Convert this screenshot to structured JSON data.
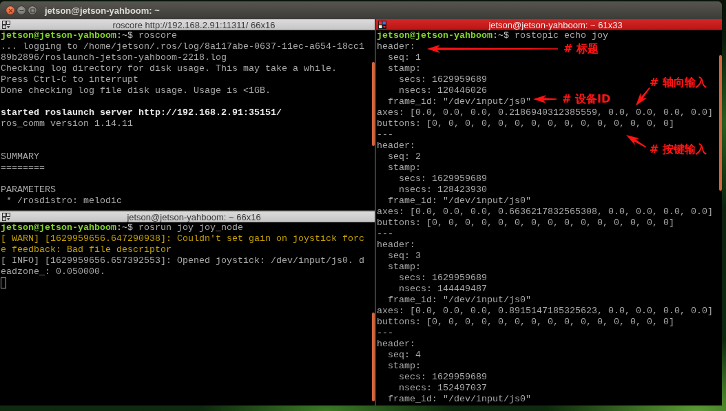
{
  "window": {
    "title": "jetson@jetson-yahboom: ~"
  },
  "columns": [
    {
      "panes": [
        {
          "title": "roscore http://192.168.2.91:11311/ 66x16",
          "focused": false,
          "cursor": false,
          "lines": [
            {
              "kind": "prompt",
              "user_host": "jetson@jetson-yahboom",
              "prompt_end": ":~$",
              "command": "roscore"
            },
            {
              "kind": "text",
              "text": "... logging to /home/jetson/.ros/log/8a117abe-0637-11ec-a654-18cc1"
            },
            {
              "kind": "text",
              "text": "89b2896/roslaunch-jetson-yahboom-2218.log"
            },
            {
              "kind": "text",
              "text": "Checking log directory for disk usage. This may take a while."
            },
            {
              "kind": "text",
              "text": "Press Ctrl-C to interrupt"
            },
            {
              "kind": "text",
              "text": "Done checking log file disk usage. Usage is <1GB."
            },
            {
              "kind": "blank"
            },
            {
              "kind": "bold",
              "text": "started roslaunch server http://192.168.2.91:35151/"
            },
            {
              "kind": "text",
              "text": "ros_comm version 1.14.11"
            },
            {
              "kind": "blank"
            },
            {
              "kind": "blank"
            },
            {
              "kind": "text",
              "text": "SUMMARY"
            },
            {
              "kind": "text",
              "text": "========"
            },
            {
              "kind": "blank"
            },
            {
              "kind": "text",
              "text": "PARAMETERS"
            },
            {
              "kind": "bullet",
              "text": "* /rosdistro: melodic"
            }
          ]
        },
        {
          "title": "jetson@jetson-yahboom: ~ 66x16",
          "focused": false,
          "cursor": true,
          "lines": [
            {
              "kind": "prompt",
              "user_host": "jetson@jetson-yahboom",
              "prompt_end": ":~$",
              "command": "rosrun joy joy_node"
            },
            {
              "kind": "warning",
              "text": "[ WARN] [1629959656.647290938]: Couldn't set gain on joystick forc"
            },
            {
              "kind": "warning",
              "text": "e feedback: Bad file descriptor"
            },
            {
              "kind": "text",
              "text": "[ INFO] [1629959656.657392553]: Opened joystick: /dev/input/js0. d"
            },
            {
              "kind": "text",
              "text": "eadzone_: 0.050000."
            }
          ]
        }
      ]
    },
    {
      "panes": [
        {
          "title": "jetson@jetson-yahboom: ~ 61x33",
          "focused": true,
          "cursor": false,
          "lines": [
            {
              "kind": "prompt",
              "user_host": "jetson@jetson-yahboom",
              "prompt_end": ":~$",
              "command": "rostopic echo joy"
            },
            {
              "kind": "text",
              "text": "header:",
              "children": [
                {
                  "kind": "text",
                  "text": "seq: 1"
                },
                {
                  "kind": "text",
                  "text": "stamp:",
                  "children": [
                    {
                      "kind": "text",
                      "text": "secs: 1629959689"
                    },
                    {
                      "kind": "text",
                      "text": "nsecs: 120446026"
                    }
                  ]
                },
                {
                  "kind": "text",
                  "text": "frame_id: \"/dev/input/js0\""
                }
              ]
            },
            {
              "kind": "text",
              "text": "axes: [0.0, 0.0, 0.0, 0.2186940312385559, 0.0, 0.0, 0.0, 0.0]"
            },
            {
              "kind": "text",
              "text": "buttons: [0, 0, 0, 0, 0, 0, 0, 0, 0, 0, 0, 0, 0, 0, 0]"
            },
            {
              "kind": "text",
              "text": "---"
            },
            {
              "kind": "text",
              "text": "header:",
              "children": [
                {
                  "kind": "text",
                  "text": "seq: 2"
                },
                {
                  "kind": "text",
                  "text": "stamp:",
                  "children": [
                    {
                      "kind": "text",
                      "text": "secs: 1629959689"
                    },
                    {
                      "kind": "text",
                      "text": "nsecs: 128423930"
                    }
                  ]
                },
                {
                  "kind": "text",
                  "text": "frame_id: \"/dev/input/js0\""
                }
              ]
            },
            {
              "kind": "text",
              "text": "axes: [0.0, 0.0, 0.0, 0.6636217832565308, 0.0, 0.0, 0.0, 0.0]"
            },
            {
              "kind": "text",
              "text": "buttons: [0, 0, 0, 0, 0, 0, 0, 0, 0, 0, 0, 0, 0, 0, 0]"
            },
            {
              "kind": "text",
              "text": "---"
            },
            {
              "kind": "text",
              "text": "header:",
              "children": [
                {
                  "kind": "text",
                  "text": "seq: 3"
                },
                {
                  "kind": "text",
                  "text": "stamp:",
                  "children": [
                    {
                      "kind": "text",
                      "text": "secs: 1629959689"
                    },
                    {
                      "kind": "text",
                      "text": "nsecs: 144449487"
                    }
                  ]
                },
                {
                  "kind": "text",
                  "text": "frame_id: \"/dev/input/js0\""
                }
              ]
            },
            {
              "kind": "text",
              "text": "axes: [0.0, 0.0, 0.0, 0.8915147185325623, 0.0, 0.0, 0.0, 0.0]"
            },
            {
              "kind": "text",
              "text": "buttons: [0, 0, 0, 0, 0, 0, 0, 0, 0, 0, 0, 0, 0, 0, 0]"
            },
            {
              "kind": "text",
              "text": "---"
            },
            {
              "kind": "text",
              "text": "header:",
              "children": [
                {
                  "kind": "text",
                  "text": "seq: 4"
                },
                {
                  "kind": "text",
                  "text": "stamp:",
                  "children": [
                    {
                      "kind": "text",
                      "text": "secs: 1629959689"
                    },
                    {
                      "kind": "text",
                      "text": "nsecs: 152497037"
                    }
                  ]
                },
                {
                  "kind": "text",
                  "text": "frame_id: \"/dev/input/js0\""
                }
              ]
            }
          ],
          "annotations": [
            {
              "text": "# 标题",
              "kind": "left"
            },
            {
              "text": "# 轴向输入",
              "kind": "downward"
            },
            {
              "text": "# 设备ID",
              "kind": "left"
            },
            {
              "text": "# 按键输入",
              "kind": "upward"
            }
          ]
        }
      ]
    }
  ]
}
